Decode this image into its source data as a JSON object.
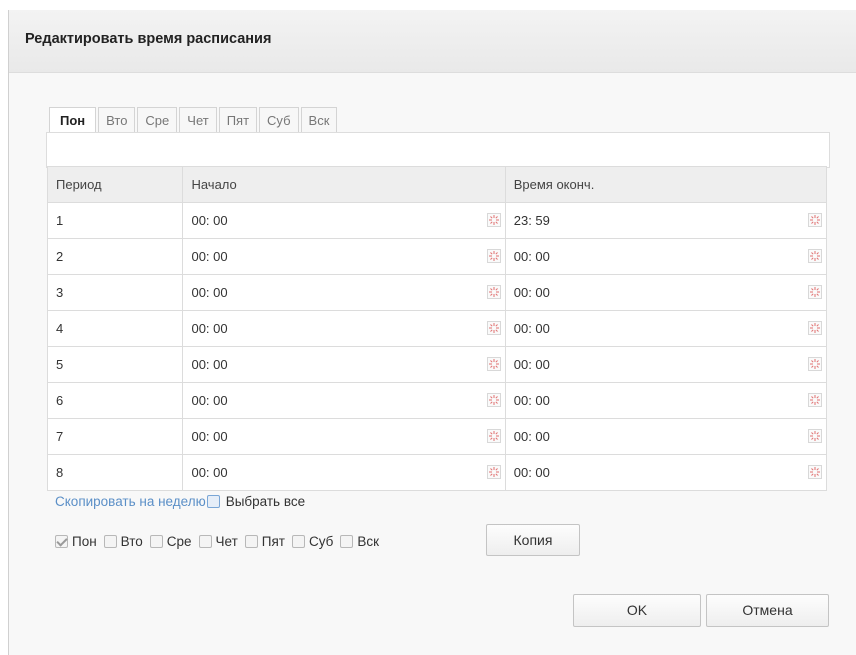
{
  "dialog": {
    "title": "Редактировать время расписания"
  },
  "tabs": [
    {
      "label": "Пон",
      "active": true
    },
    {
      "label": "Вто",
      "active": false
    },
    {
      "label": "Сре",
      "active": false
    },
    {
      "label": "Чет",
      "active": false
    },
    {
      "label": "Пят",
      "active": false
    },
    {
      "label": "Суб",
      "active": false
    },
    {
      "label": "Вск",
      "active": false
    }
  ],
  "table": {
    "headers": [
      "Период",
      "Начало",
      "Время оконч."
    ],
    "rows": [
      {
        "period": "1",
        "start": "00: 00",
        "end": "23: 59"
      },
      {
        "period": "2",
        "start": "00: 00",
        "end": "00: 00"
      },
      {
        "period": "3",
        "start": "00: 00",
        "end": "00: 00"
      },
      {
        "period": "4",
        "start": "00: 00",
        "end": "00: 00"
      },
      {
        "period": "5",
        "start": "00: 00",
        "end": "00: 00"
      },
      {
        "period": "6",
        "start": "00: 00",
        "end": "00: 00"
      },
      {
        "period": "7",
        "start": "00: 00",
        "end": "00: 00"
      },
      {
        "period": "8",
        "start": "00: 00",
        "end": "00: 00"
      }
    ],
    "picker_icon": "time-picker-icon"
  },
  "copy": {
    "link_text": "Скопировать на неделю",
    "select_all_label": "Выбрать все",
    "select_all_checked": false,
    "days": [
      {
        "label": "Пон",
        "checked": true
      },
      {
        "label": "Вто",
        "checked": false
      },
      {
        "label": "Сре",
        "checked": false
      },
      {
        "label": "Чет",
        "checked": false
      },
      {
        "label": "Пят",
        "checked": false
      },
      {
        "label": "Суб",
        "checked": false
      },
      {
        "label": "Вск",
        "checked": false
      }
    ],
    "copy_button": "Копия"
  },
  "footer": {
    "ok_label": "OK",
    "cancel_label": "Отмена"
  },
  "colors": {
    "link": "#5b8fc7",
    "picker_icon": "#e07070"
  }
}
